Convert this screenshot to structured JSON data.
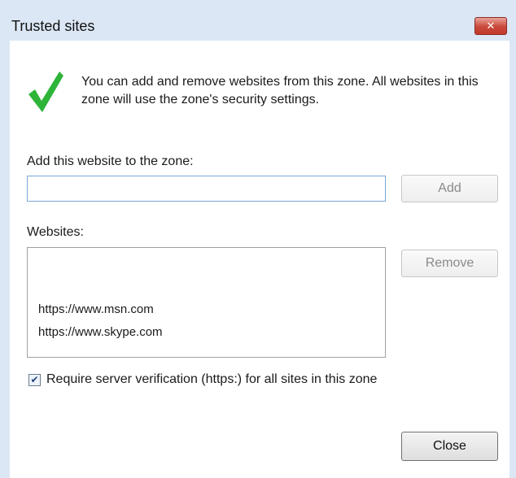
{
  "window": {
    "title": "Trusted sites",
    "close_glyph": "✕"
  },
  "intro_text": "You can add and remove websites from this zone. All websites in this zone will use the zone's security settings.",
  "icons": {
    "status": "checkmark-icon",
    "status_color": "#2fb43a"
  },
  "add": {
    "label": "Add this website to the zone:",
    "input_value": "",
    "button_label": "Add"
  },
  "websites": {
    "label": "Websites:",
    "items": [
      "https://www.msn.com",
      "https://www.skype.com"
    ],
    "remove_label": "Remove"
  },
  "verification": {
    "checked": true,
    "check_glyph": "✔",
    "label": "Require server verification (https:) for all sites in this zone"
  },
  "footer": {
    "close_label": "Close"
  }
}
